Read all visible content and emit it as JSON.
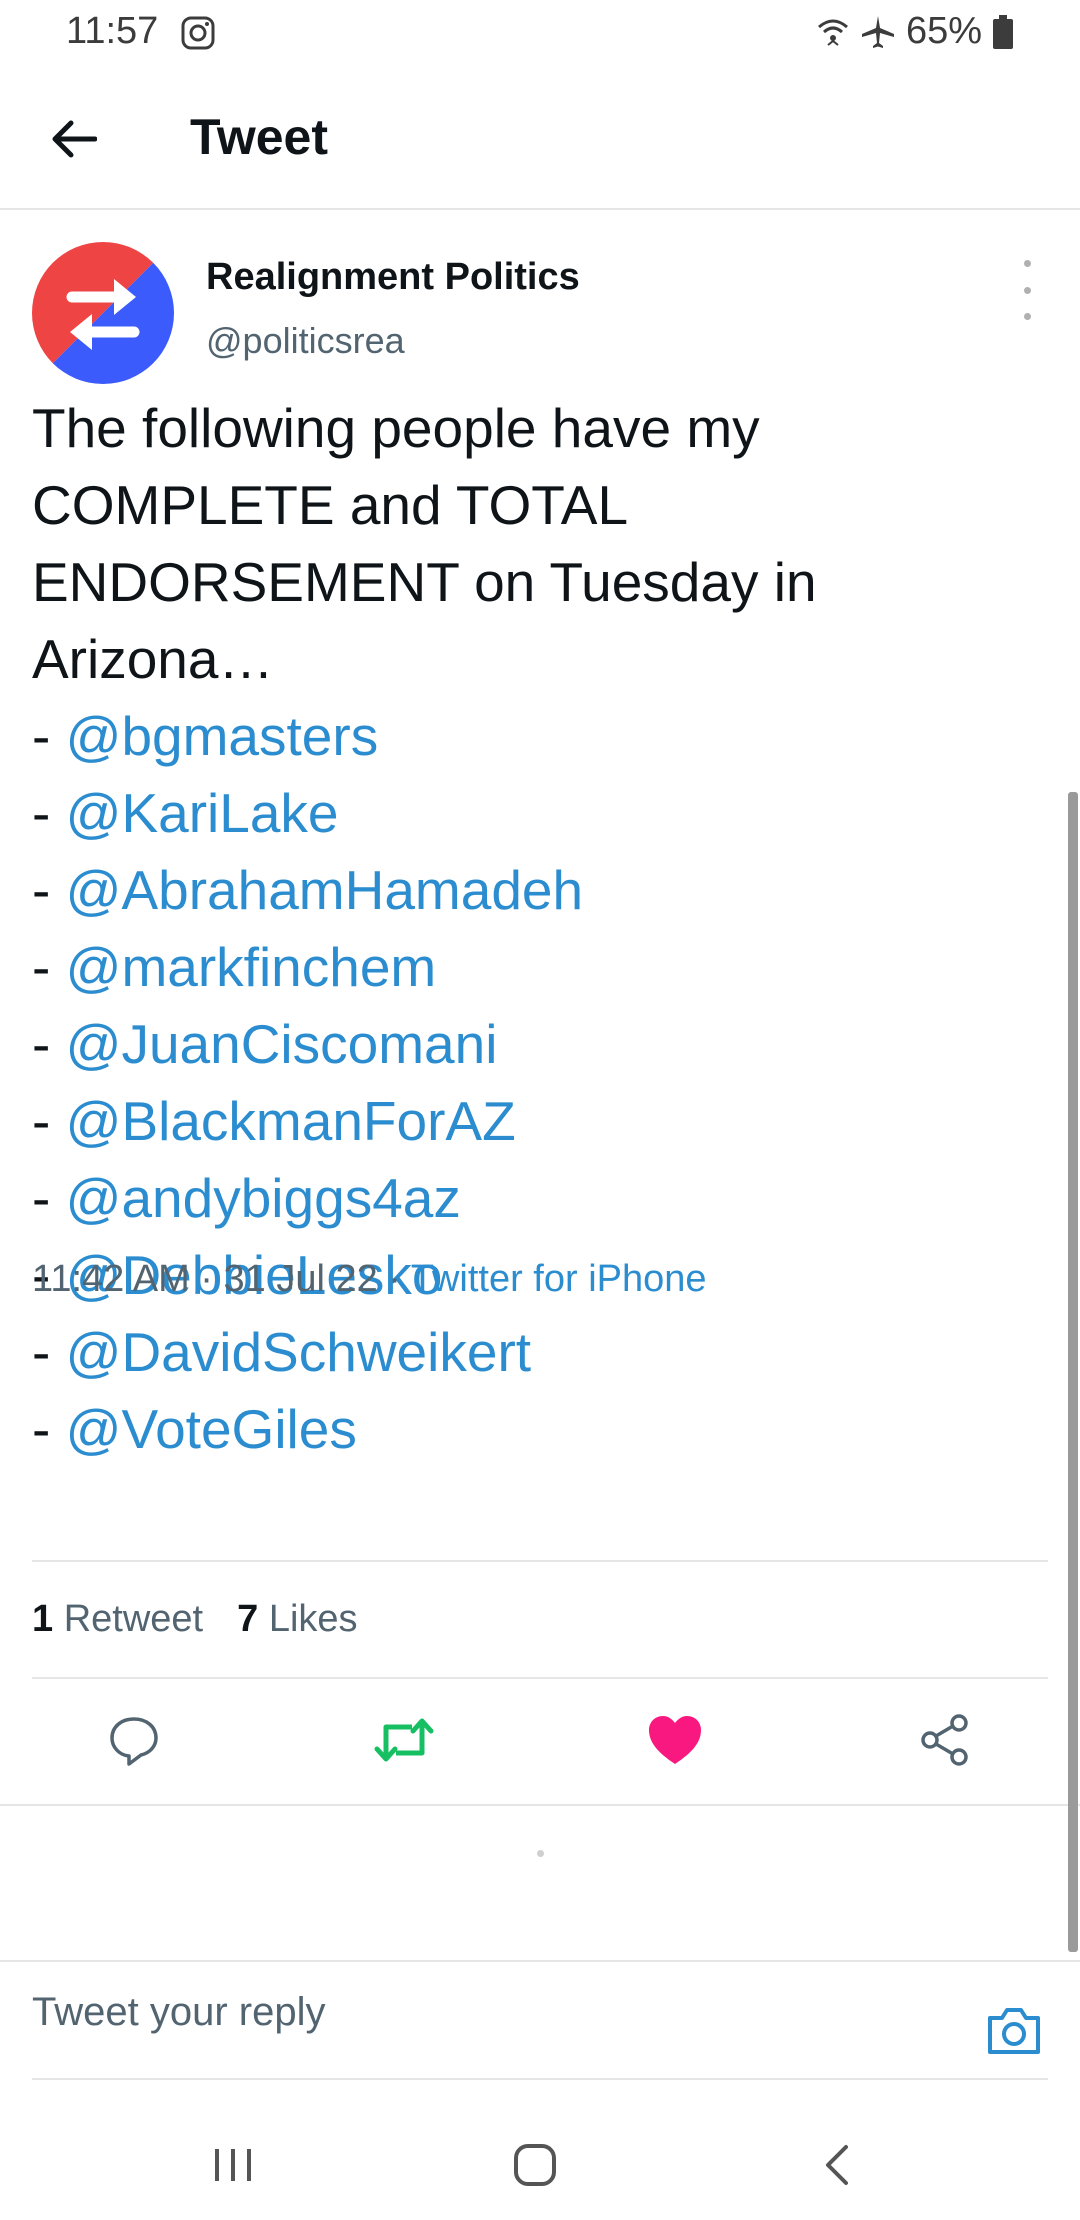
{
  "status_bar": {
    "time": "11:57",
    "battery": "65%"
  },
  "header": {
    "title": "Tweet"
  },
  "tweet": {
    "author_name": "Realignment Politics",
    "author_handle": "@politicsrea",
    "text_lines": [
      "The following people have my",
      "COMPLETE and TOTAL",
      "ENDORSEMENT on Tuesday in",
      "Arizona…"
    ],
    "mention_prefix": "- ",
    "mentions": [
      "@bgmasters",
      "@KariLake",
      "@AbrahamHamadeh",
      "@markfinchem",
      "@JuanCiscomani",
      "@BlackmanForAZ",
      "@andybiggs4az",
      "@DebbieLesko",
      "@DavidSchweikert",
      "@VoteGiles"
    ],
    "time": "11:42 AM",
    "separator": " · ",
    "date": "31 Jul 22",
    "source": "Twitter for iPhone",
    "retweet_count": "1",
    "retweet_label": "Retweet",
    "likes_count": "7",
    "likes_label": "Likes"
  },
  "reply": {
    "placeholder": "Tweet your reply"
  },
  "colors": {
    "link": "#2b8dcf",
    "retweet_active": "#17bf63",
    "like_active": "#f91880",
    "avatar_red": "#ef4444",
    "avatar_blue": "#3b5bfd"
  },
  "icons": {
    "back": "arrow-left-icon",
    "more": "more-vertical-icon",
    "reply": "comment-icon",
    "retweet": "retweet-icon",
    "like": "heart-icon",
    "share": "share-icon",
    "camera": "camera-icon"
  }
}
